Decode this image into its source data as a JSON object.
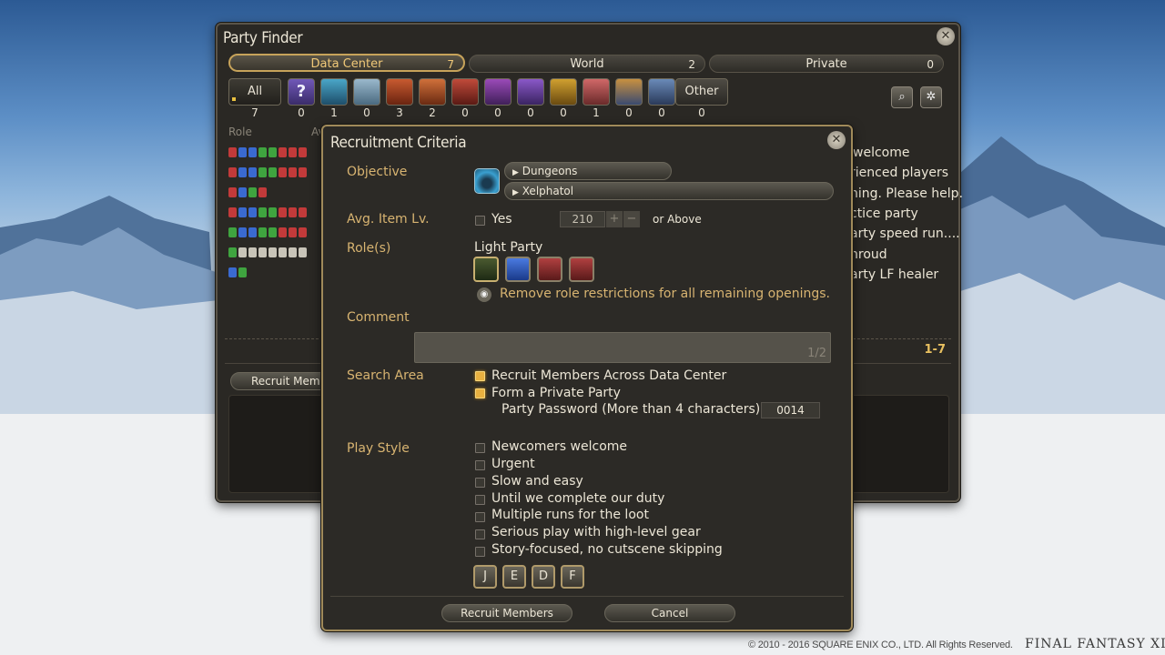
{
  "party_finder": {
    "title": "Party Finder",
    "tabs": [
      {
        "label": "Data Center",
        "count": "7"
      },
      {
        "label": "World",
        "count": "2"
      },
      {
        "label": "Private",
        "count": "0"
      }
    ],
    "all_label": "All",
    "all_count": "7",
    "category_icons": [
      "question-icon",
      "dungeon-icon",
      "guildhest-icon",
      "trial-icon",
      "raid-icon",
      "pvp-icon",
      "sword-icon",
      "crystal-icon",
      "treasure-icon",
      "fate-icon",
      "deep-dungeon-icon",
      "event-icon"
    ],
    "category_counts": [
      "0",
      "1",
      "0",
      "3",
      "2",
      "0",
      "0",
      "0",
      "0",
      "1",
      "0",
      "0"
    ],
    "other_label": "Other",
    "other_count": "0",
    "role_header": "Role",
    "avg_header": "Av",
    "listing_fragments": [
      "welcome",
      "rienced players",
      "ning. Please help.",
      "ctice party",
      "arty speed run....",
      "hroud",
      "arty LF healer"
    ],
    "page_range": "1-7",
    "recruit_button_partial": "Recruit Memb"
  },
  "criteria": {
    "title": "Recruitment Criteria",
    "objective_label": "Objective",
    "objective_category": "Dungeons",
    "objective_duty": "Xelphatol",
    "avg_ilvl_label": "Avg. Item Lv.",
    "avg_ilvl_checkbox_label": "Yes",
    "avg_ilvl_value": "210",
    "or_above": "or Above",
    "roles_label": "Role(s)",
    "party_type": "Light Party",
    "remove_roles_text": "Remove role restrictions for all remaining openings.",
    "comment_label": "Comment",
    "comment_page": "1/2",
    "search_area_label": "Search Area",
    "search_area_options": [
      {
        "label": "Recruit Members Across Data Center",
        "checked": true
      },
      {
        "label": "Form a Private Party",
        "checked": true
      }
    ],
    "password_label": "Party Password (More than 4 characters)",
    "password_value": "0014",
    "play_style_label": "Play Style",
    "play_styles": [
      "Newcomers welcome",
      "Urgent",
      "Slow and easy",
      "Until we complete our duty",
      "Multiple runs for the loot",
      "Serious play with high-level gear",
      "Story-focused, no cutscene skipping"
    ],
    "language_buttons": [
      "J",
      "E",
      "D",
      "F"
    ],
    "recruit_button": "Recruit Members",
    "cancel_button": "Cancel"
  },
  "footer": {
    "copyright": "© 2010 - 2016 SQUARE ENIX CO., LTD. All Rights Reserved.",
    "logo_text": "FINAL FANTASY XIV"
  },
  "colors": {
    "accent_gold": "#d8b471",
    "checkbox_on": "#e8b040",
    "tank": "#3a6ad0",
    "healer": "#3fa43f",
    "dps": "#c23a3a"
  }
}
